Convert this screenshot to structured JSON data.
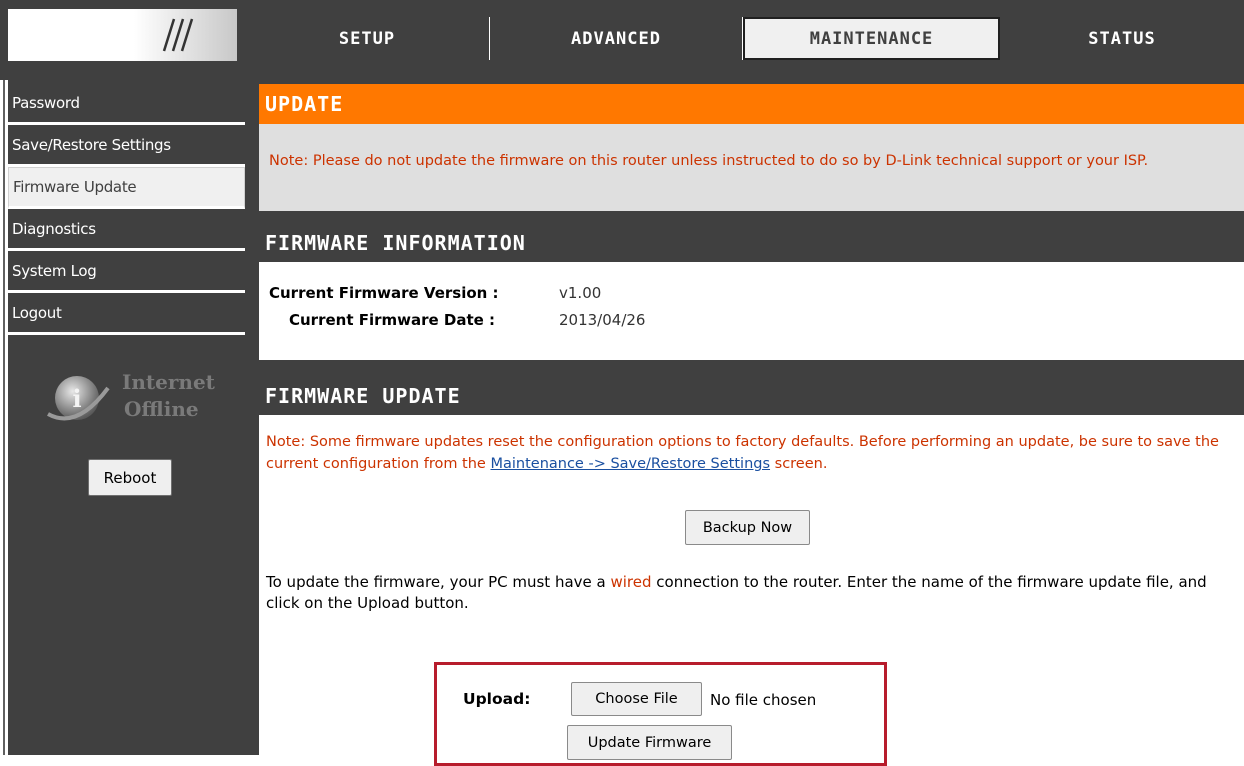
{
  "tabs": [
    {
      "label": "SETUP",
      "active": false
    },
    {
      "label": "ADVANCED",
      "active": false
    },
    {
      "label": "MAINTENANCE",
      "active": true
    },
    {
      "label": "STATUS",
      "active": false
    }
  ],
  "sidebar": {
    "items": [
      {
        "label": "Password",
        "active": false
      },
      {
        "label": "Save/Restore Settings",
        "active": false
      },
      {
        "label": "Firmware Update",
        "active": true
      },
      {
        "label": "Diagnostics",
        "active": false
      },
      {
        "label": "System Log",
        "active": false
      },
      {
        "label": "Logout",
        "active": false
      }
    ],
    "status_line1": "Internet",
    "status_line2": "Offline",
    "reboot_label": "Reboot"
  },
  "update": {
    "title": "UPDATE",
    "note": "Note: Please do not update the firmware on this router unless instructed to do so by D-Link technical support or your ISP."
  },
  "firmware_info": {
    "title": "FIRMWARE INFORMATION",
    "version_label": "Current Firmware Version :",
    "version_value": "v1.00",
    "date_label": "Current Firmware Date :",
    "date_value": "2013/04/26"
  },
  "firmware_update": {
    "title": "FIRMWARE UPDATE",
    "note_before": "Note: Some firmware updates reset the configuration options to factory defaults. Before performing an update, be sure to save the current configuration from the ",
    "note_link": "Maintenance -> Save/Restore Settings",
    "note_after": " screen.",
    "backup_label": "Backup Now",
    "instructions_before": "To update the firmware, your PC must have a ",
    "instructions_wired": "wired",
    "instructions_after": " connection to the router. Enter the name of the firmware update file, and click on the Upload button.",
    "upload_label": "Upload:",
    "choose_file_label": "Choose File",
    "no_file_text": "No file chosen",
    "update_button_label": "Update Firmware"
  },
  "colors": {
    "accent_orange": "#ff7800",
    "dark_gray": "#404040",
    "note_red": "#cc3300",
    "highlight_frame": "#b71c2c",
    "link_blue": "#1a4fa0"
  },
  "icons": {
    "logo": "slashes-logo-icon",
    "status": "info-globe-icon"
  }
}
